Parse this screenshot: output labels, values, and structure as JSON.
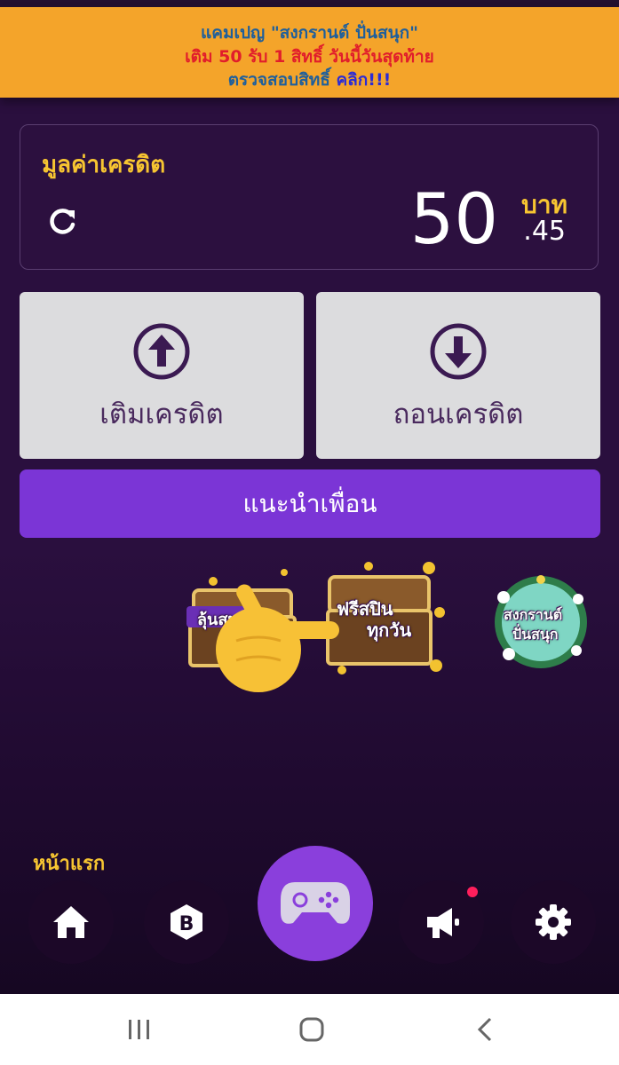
{
  "banner": {
    "line1": "แคมเปญ \"สงกรานต์ ปั่นสนุก\"",
    "line2": "เติม 50 รับ 1 สิทธิ์ วันนี้วันสุดท้าย",
    "line3_prefix": "ตรวจสอบสิทธิ์ ",
    "line3_click": "คลิก!!!",
    "bg_color": "#f4a42a"
  },
  "credit": {
    "title": "มูลค่าเครดิต",
    "amount_integer": "50",
    "amount_decimal": ".45",
    "currency": "บาท",
    "refresh_icon": "refresh-icon"
  },
  "actions": {
    "deposit_label": "เติมเครดิต",
    "deposit_icon": "arrow-up-circle-icon",
    "withdraw_label": "ถอนเครดิต",
    "withdraw_icon": "arrow-down-circle-icon"
  },
  "refer": {
    "label": "แนะนำเพื่อน",
    "color": "#7b35d6"
  },
  "promos": {
    "chest_label": "ลุ้นสนุก",
    "spin_label_1": "ฟรีสปิน",
    "spin_label_2": "ทุกวัน",
    "songkran_label_1": "สงกรานต์",
    "songkran_label_2": "ปั่นสนุก"
  },
  "bottom_nav": {
    "active_label": "หน้าแรก",
    "items": [
      "home-icon",
      "bank-coin-icon",
      "gamepad-icon",
      "megaphone-icon",
      "gear-icon"
    ],
    "active_color": "#8a3fdc"
  },
  "accent_yellow": "#f7c531"
}
